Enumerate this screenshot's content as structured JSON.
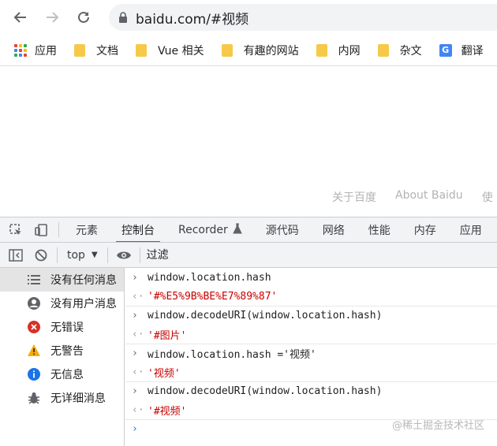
{
  "browser": {
    "url": "baidu.com/#视频",
    "bookmarks": [
      {
        "label": "应用",
        "kind": "apps"
      },
      {
        "label": "文档",
        "kind": "folder"
      },
      {
        "label": "Vue 相关",
        "kind": "folder"
      },
      {
        "label": "有趣的网站",
        "kind": "folder"
      },
      {
        "label": "内网",
        "kind": "folder"
      },
      {
        "label": "杂文",
        "kind": "folder"
      },
      {
        "label": "翻译",
        "kind": "translate"
      }
    ]
  },
  "page": {
    "footer_links": [
      "关于百度",
      "About Baidu",
      "使"
    ]
  },
  "devtools": {
    "tabs": [
      "元素",
      "控制台",
      "Recorder",
      "源代码",
      "网络",
      "性能",
      "内存",
      "应用"
    ],
    "active_tab": "控制台",
    "context": "top",
    "filter_placeholder": "过滤",
    "sidebar": [
      {
        "label": "没有任何消息",
        "icon": "list-icon",
        "selected": true
      },
      {
        "label": "没有用户消息",
        "icon": "user-icon",
        "selected": false
      },
      {
        "label": "无错误",
        "icon": "error-icon",
        "selected": false
      },
      {
        "label": "无警告",
        "icon": "warning-icon",
        "selected": false
      },
      {
        "label": "无信息",
        "icon": "info-icon",
        "selected": false
      },
      {
        "label": "无详细消息",
        "icon": "bug-icon",
        "selected": false
      }
    ],
    "console": [
      {
        "type": "input",
        "text": "window.location.hash"
      },
      {
        "type": "result",
        "text": "'#%E5%9B%BE%E7%89%87'"
      },
      {
        "type": "input",
        "text": "window.decodeURI(window.location.hash)"
      },
      {
        "type": "result",
        "text": "'#图片'"
      },
      {
        "type": "input",
        "text": "window.location.hash ='视频'"
      },
      {
        "type": "result",
        "text": "'视频'"
      },
      {
        "type": "input",
        "text": "window.decodeURI(window.location.hash)"
      },
      {
        "type": "result",
        "text": "'#视频'"
      }
    ],
    "watermark": "@稀土掘金技术社区"
  }
}
